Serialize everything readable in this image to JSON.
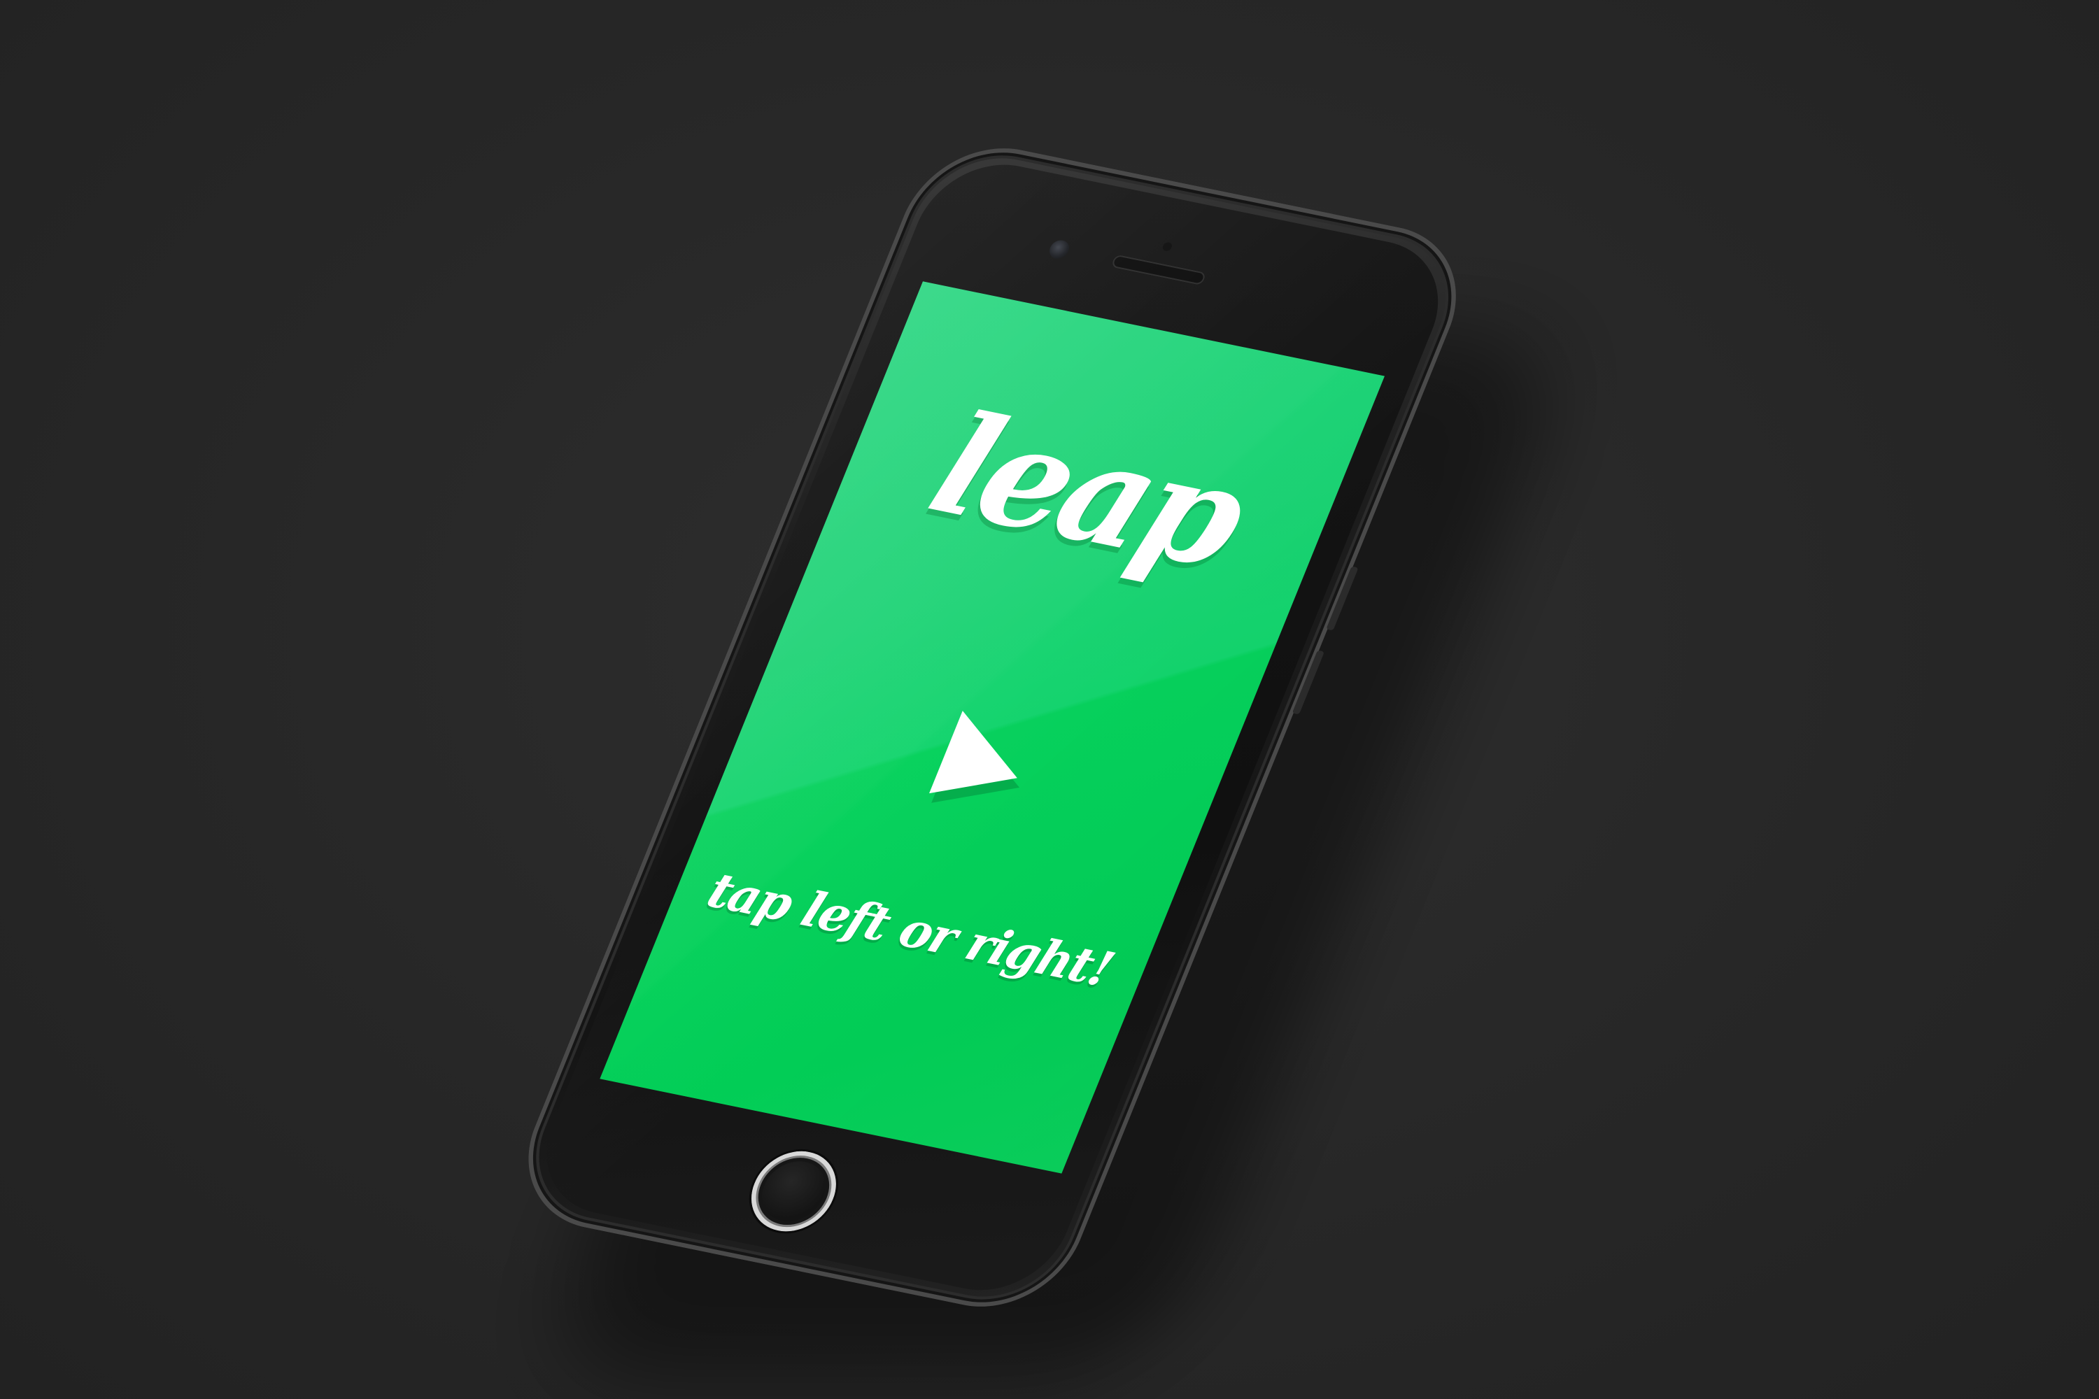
{
  "app": {
    "logo_text": "leap",
    "hint_text": "tap left or right!",
    "play_icon": "play-triangle-icon"
  },
  "colors": {
    "background": "#2a2a2a",
    "screen_green": "#1ad273",
    "screen_green_dark": "#02cf57",
    "text": "#ffffff",
    "phone_body": "#141414"
  },
  "device": {
    "home_button_icon": "home-button-ring-icon"
  }
}
